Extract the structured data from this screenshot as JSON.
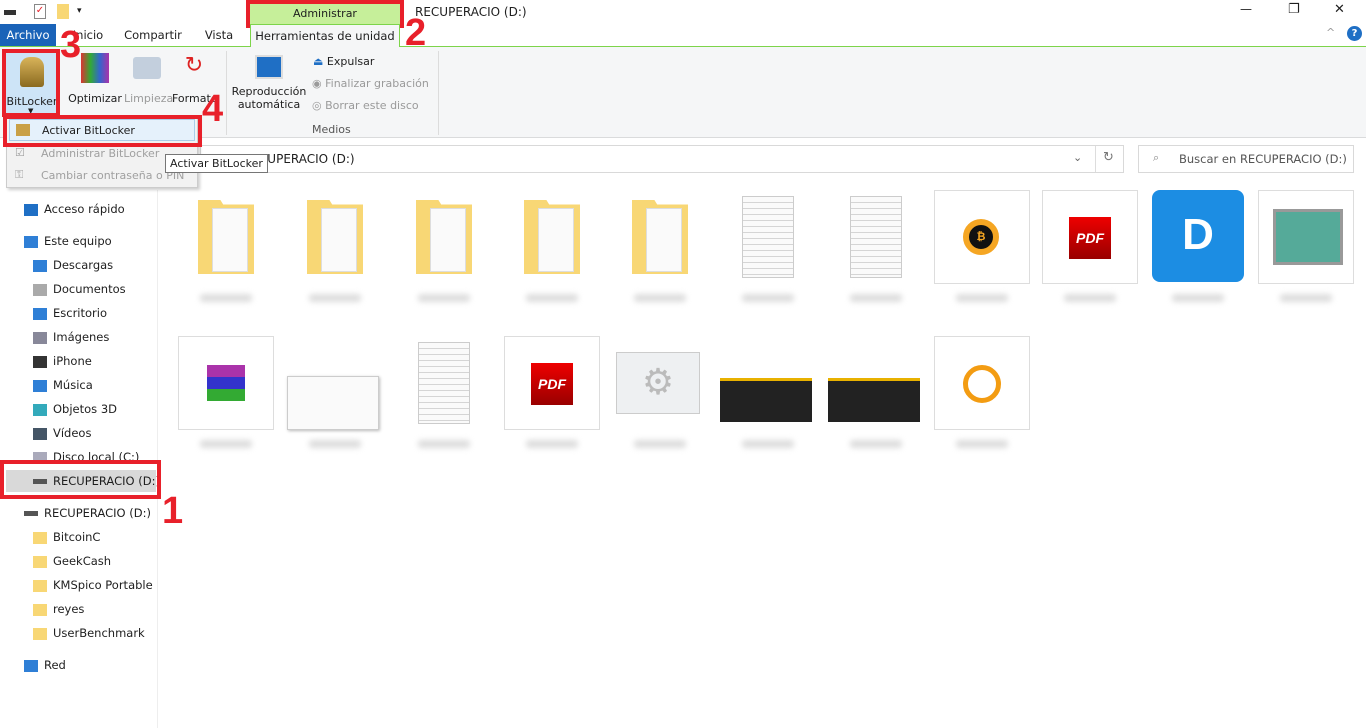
{
  "window": {
    "title": "RECUPERACIO (D:)",
    "minimize": "—",
    "restore": "❐",
    "close": "✕"
  },
  "ribbon": {
    "context_tab": "Administrar",
    "tabs": [
      "Archivo",
      "Inicio",
      "Compartir",
      "Vista",
      "Herramientas de unidad"
    ],
    "collapse": "^",
    "help": "?",
    "buttons": {
      "bitlocker": "BitLocker",
      "optimizar": "Optimizar",
      "limpieza": "Limpieza",
      "formatear": "Formatear",
      "reproduccion": "Reproducción automática",
      "expulsar": "Expulsar",
      "finalizar": "Finalizar grabación",
      "borrar": "Borrar este disco"
    },
    "group_medios": "Medios"
  },
  "dropdown": {
    "items": [
      "Activar BitLocker",
      "Administrar BitLocker",
      "Cambiar contraseña o PIN"
    ],
    "tooltip": "Activar BitLocker"
  },
  "address": {
    "path": "RECUPERACIO (D:)",
    "search_placeholder": "Buscar en RECUPERACIO (D:)"
  },
  "sidebar": {
    "items": [
      "Acceso rápido",
      "Este equipo",
      "Descargas",
      "Documentos",
      "Escritorio",
      "Imágenes",
      "iPhone",
      "Música",
      "Objetos 3D",
      "Vídeos",
      "Disco local (C:)",
      "RECUPERACIO (D:)",
      "RECUPERACIO (D:)",
      "BitcoinC",
      "GeekCash",
      "KMSpico Portable",
      "reyes",
      "UserBenchmark",
      "Red"
    ]
  },
  "annotations": [
    "1",
    "2",
    "3",
    "4"
  ],
  "files": {
    "row1": [
      "folder",
      "folder",
      "folder",
      "folder",
      "folder",
      "document",
      "document",
      "bitcoin-app",
      "pdf",
      "dash-app",
      "network-card"
    ],
    "row2": [
      "winrar",
      "screenshot",
      "document",
      "pdf",
      "gears",
      "dark-screenshot",
      "dark-screenshot",
      "gauge-shield"
    ]
  },
  "colors": {
    "accent": "#1f6fc5",
    "context": "#c6ef9a",
    "annotation": "#e8202a",
    "archivo": "#1a63b8"
  }
}
